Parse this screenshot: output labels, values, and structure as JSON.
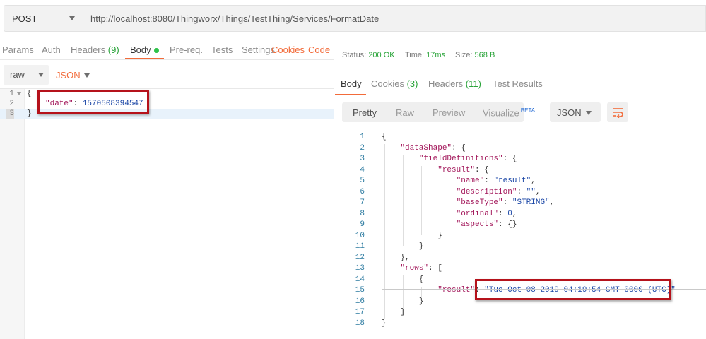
{
  "request": {
    "method": "POST",
    "url": "http://localhost:8080/Thingworx/Things/TestThing/Services/FormatDate"
  },
  "left_tabs": {
    "params": "Params",
    "auth": "Auth",
    "headers": "Headers",
    "headers_count": "(9)",
    "body": "Body",
    "prereq": "Pre-req.",
    "tests": "Tests",
    "settings": "Settings",
    "cookies": "Cookies",
    "code": "Code"
  },
  "body_type": {
    "mode": "raw",
    "format": "JSON"
  },
  "request_body": {
    "lines": [
      {
        "num": "1",
        "text": "{"
      },
      {
        "num": "2",
        "key": "\"date\"",
        "sep": ": ",
        "value": "1570508394547"
      },
      {
        "num": "3",
        "text": "}"
      }
    ]
  },
  "response_status": {
    "status_label": "Status:",
    "status_value": "200 OK",
    "time_label": "Time:",
    "time_value": "17ms",
    "size_label": "Size:",
    "size_value": "568 B"
  },
  "response_tabs": {
    "body": "Body",
    "cookies": "Cookies",
    "cookies_count": "(3)",
    "headers": "Headers",
    "headers_count": "(11)",
    "test_results": "Test Results"
  },
  "view_modes": {
    "pretty": "Pretty",
    "raw": "Raw",
    "preview": "Preview",
    "visualize": "Visualize",
    "beta": "BETA",
    "format": "JSON",
    "wrap_icon": "wrap-lines-icon"
  },
  "response_body": {
    "lines": [
      {
        "num": "1",
        "indent": "",
        "text": "{"
      },
      {
        "num": "2",
        "indent": "    ",
        "key": "\"dataShape\"",
        "rest": ": {"
      },
      {
        "num": "3",
        "indent": "        ",
        "key": "\"fieldDefinitions\"",
        "rest": ": {"
      },
      {
        "num": "4",
        "indent": "            ",
        "key": "\"result\"",
        "rest": ": {"
      },
      {
        "num": "5",
        "indent": "                ",
        "key": "\"name\"",
        "rest": ": ",
        "str": "\"result\"",
        "tail": ","
      },
      {
        "num": "6",
        "indent": "                ",
        "key": "\"description\"",
        "rest": ": ",
        "str": "\"\"",
        "tail": ","
      },
      {
        "num": "7",
        "indent": "                ",
        "key": "\"baseType\"",
        "rest": ": ",
        "str": "\"STRING\"",
        "tail": ","
      },
      {
        "num": "8",
        "indent": "                ",
        "key": "\"ordinal\"",
        "rest": ": ",
        "str": "0",
        "tail": ","
      },
      {
        "num": "9",
        "indent": "                ",
        "key": "\"aspects\"",
        "rest": ": {}"
      },
      {
        "num": "10",
        "indent": "            ",
        "text": "}"
      },
      {
        "num": "11",
        "indent": "        ",
        "text": "}"
      },
      {
        "num": "12",
        "indent": "    ",
        "text": "},"
      },
      {
        "num": "13",
        "indent": "    ",
        "key": "\"rows\"",
        "rest": ": ["
      },
      {
        "num": "14",
        "indent": "        ",
        "text": "{"
      },
      {
        "num": "15",
        "indent": "            ",
        "key": "\"result\"",
        "rest": ": ",
        "str": "\"Tue Oct 08 2019 04:19:54 GMT-0000 (UTC)\""
      },
      {
        "num": "16",
        "indent": "        ",
        "text": "}"
      },
      {
        "num": "17",
        "indent": "    ",
        "text": "]"
      },
      {
        "num": "18",
        "indent": "",
        "text": "}"
      }
    ]
  },
  "colors": {
    "accent": "#f26b3a",
    "success": "#2aa43a",
    "highlight_border": "#b5121b",
    "json_key": "#a3185b",
    "json_value": "#1a46a6"
  }
}
